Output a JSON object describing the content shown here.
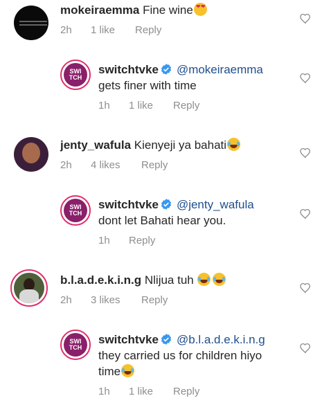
{
  "icons": {
    "like": "heart-outline-icon",
    "verified": "verified-badge-icon"
  },
  "colors": {
    "mention": "#1f4e8c",
    "meta": "#8e8e8e",
    "ring": "#e02d6b",
    "verified": "#3897f0"
  },
  "avatar_text": {
    "switchtv": "SWI TCH"
  },
  "comments": [
    {
      "username": "mokeiraemma",
      "text": "Fine wine",
      "emoji": "😍",
      "time": "2h",
      "likes": "1 like",
      "reply": "Reply"
    },
    {
      "username": "switchtvke",
      "mention": "@mokeiraemma",
      "text": "gets finer with time",
      "time": "1h",
      "likes": "1 like",
      "reply": "Reply"
    },
    {
      "username": "jenty_wafula",
      "text": "Kienyeji ya bahati",
      "emoji": "😂",
      "time": "2h",
      "likes": "4 likes",
      "reply": "Reply"
    },
    {
      "username": "switchtvke",
      "mention": "@jenty_wafula",
      "text": "dont let Bahati hear you.",
      "time": "1h",
      "reply": "Reply"
    },
    {
      "username": "b.l.a.d.e.k.i.n.g",
      "text": "Nlijua tuh",
      "emoji": "😂😂",
      "time": "2h",
      "likes": "3 likes",
      "reply": "Reply"
    },
    {
      "username": "switchtvke",
      "mention": "@b.l.a.d.e.k.i.n.g",
      "text": "they carried us for children hiyo",
      "text2": "time",
      "emoji": "😂",
      "time": "1h",
      "likes": "1 like",
      "reply": "Reply"
    }
  ]
}
